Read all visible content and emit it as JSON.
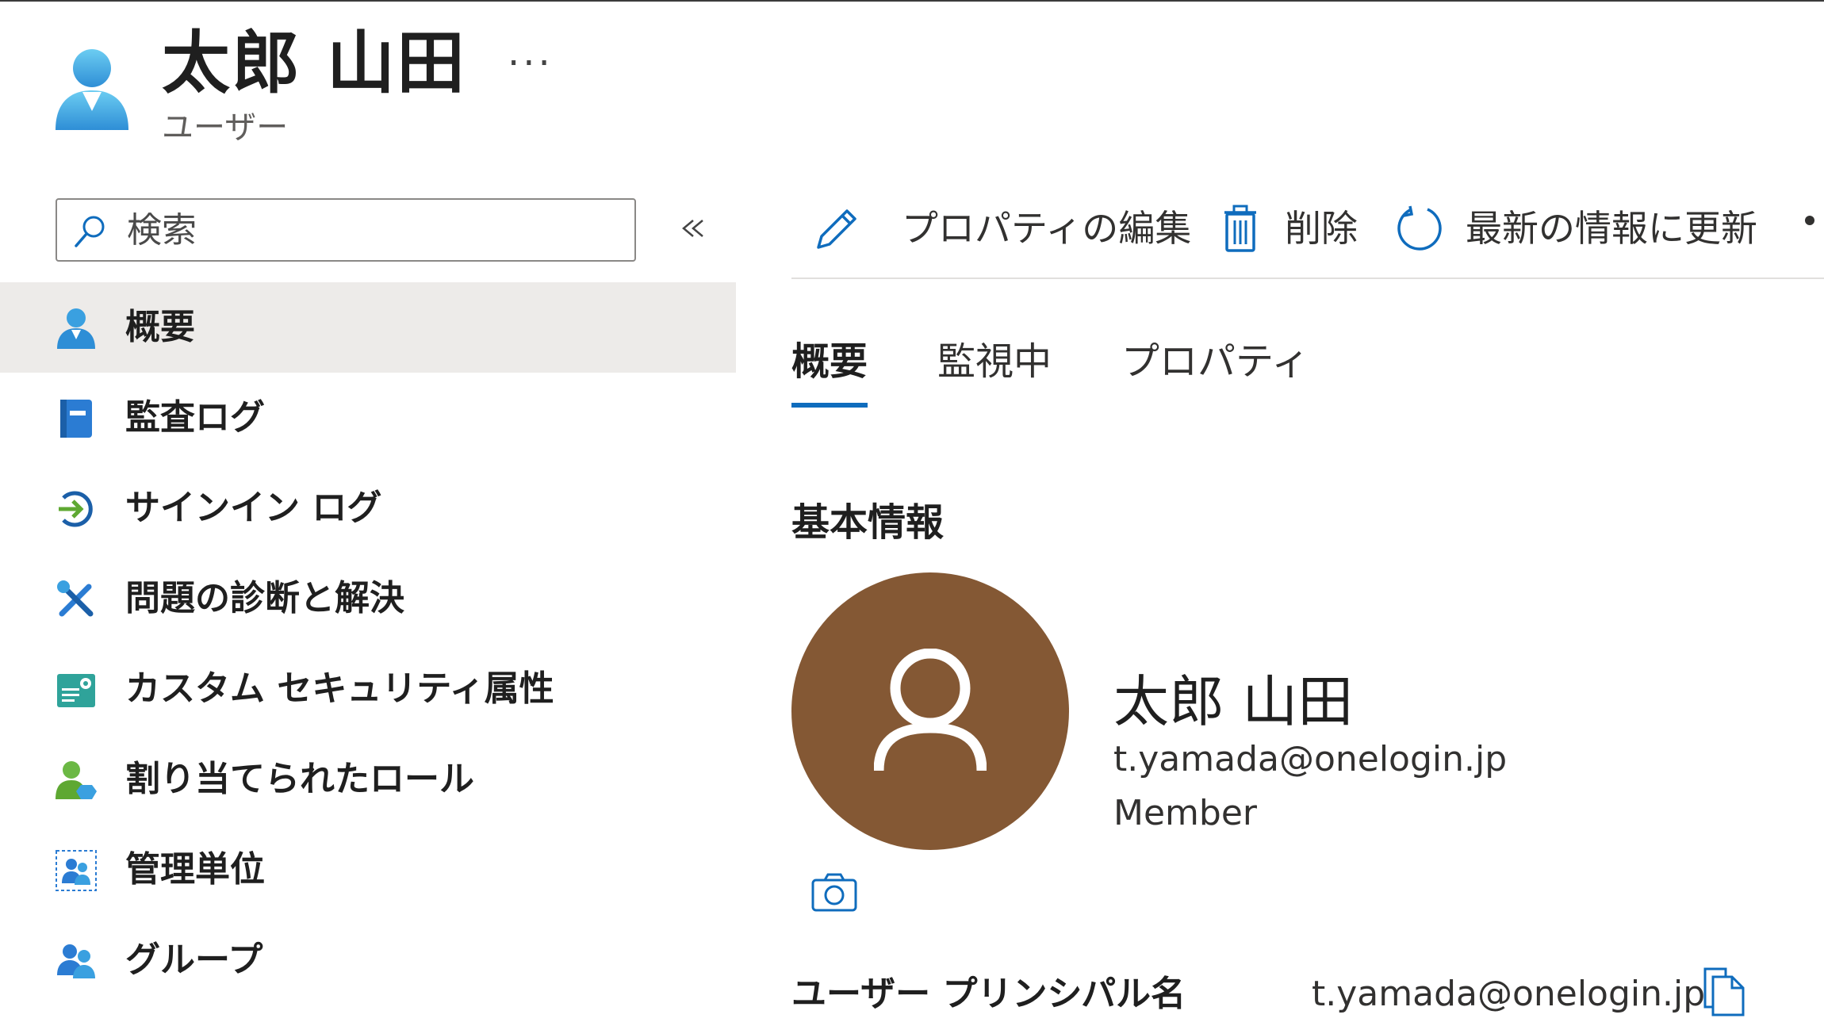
{
  "header": {
    "title": "太郎 山田",
    "subtitle": "ユーザー",
    "more_label": "···"
  },
  "search": {
    "placeholder": "検索"
  },
  "sidebar": {
    "items": [
      {
        "label": "概要",
        "icon": "user-icon",
        "selected": true
      },
      {
        "label": "監査ログ",
        "icon": "audit-log-icon"
      },
      {
        "label": "サインイン ログ",
        "icon": "sign-in-icon"
      },
      {
        "label": "問題の診断と解決",
        "icon": "wrench-screwdriver-icon"
      },
      {
        "label": "カスタム セキュリティ属性",
        "icon": "custom-attributes-icon"
      },
      {
        "label": "割り当てられたロール",
        "icon": "assigned-roles-icon"
      },
      {
        "label": "管理単位",
        "icon": "administrative-units-icon"
      },
      {
        "label": "グループ",
        "icon": "groups-icon"
      }
    ]
  },
  "toolbar": {
    "edit_label": "プロパティの編集",
    "delete_label": "削除",
    "refresh_label": "最新の情報に更新"
  },
  "tabs": [
    {
      "label": "概要",
      "active": true
    },
    {
      "label": "監視中"
    },
    {
      "label": "プロパティ"
    }
  ],
  "basic_info": {
    "title": "基本情報",
    "name": "太郎 山田",
    "email": "t.yamada@onelogin.jp",
    "user_type": "Member"
  },
  "upn": {
    "label": "ユーザー プリンシパル名",
    "value": "t.yamada@onelogin.jp"
  },
  "colors": {
    "accent": "#0f6cbd",
    "avatar_bg": "#845834",
    "selected_bg": "#edebe9"
  }
}
